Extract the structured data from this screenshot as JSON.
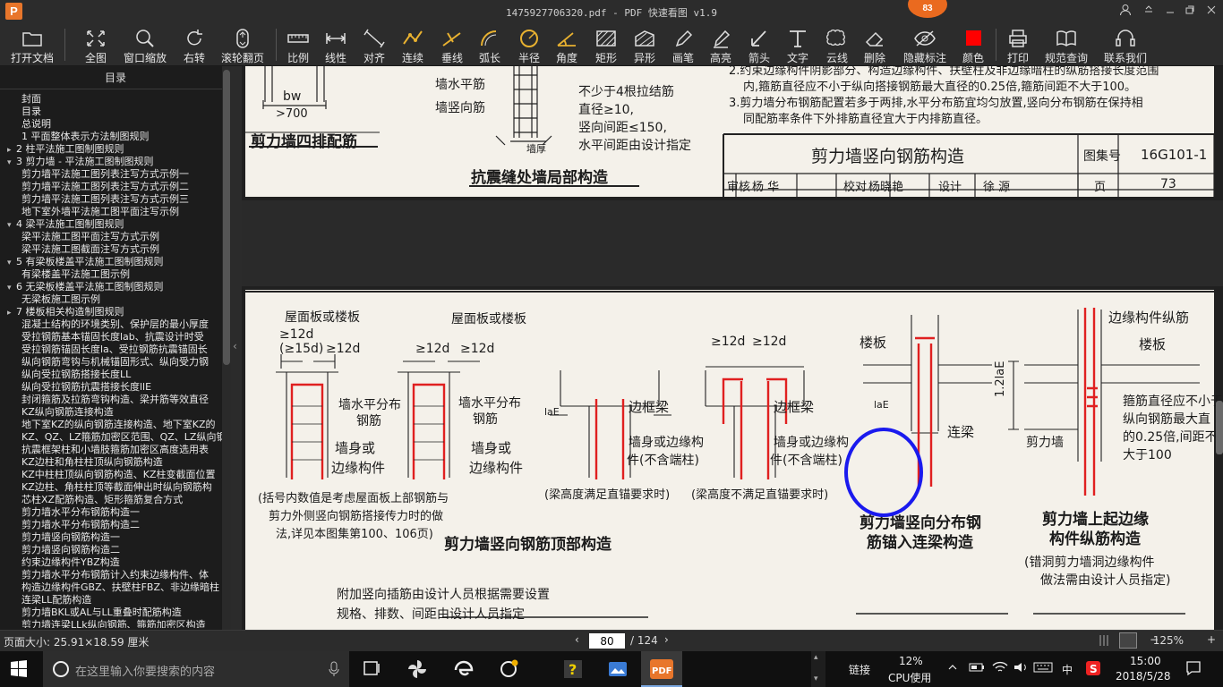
{
  "window": {
    "logo": "P",
    "title": "1475927706320.pdf - PDF 快速看图 v1.9",
    "badge": "83"
  },
  "toolbar": {
    "items": [
      {
        "label": "打开文档",
        "icon": "folder-icon"
      },
      {
        "label": "全图",
        "icon": "fit-page-icon"
      },
      {
        "label": "窗口缩放",
        "icon": "zoom-window-icon"
      },
      {
        "label": "右转",
        "icon": "rotate-right-icon"
      },
      {
        "label": "滚轮翻页",
        "icon": "mouse-wheel-icon"
      },
      {
        "label": "比例",
        "icon": "ruler-icon"
      },
      {
        "label": "线性",
        "icon": "linear-dimension-icon"
      },
      {
        "label": "对齐",
        "icon": "aligned-dimension-icon"
      },
      {
        "label": "连续",
        "icon": "continuous-dimension-icon"
      },
      {
        "label": "垂线",
        "icon": "perpendicular-icon"
      },
      {
        "label": "弧长",
        "icon": "arc-length-icon"
      },
      {
        "label": "半径",
        "icon": "radius-icon"
      },
      {
        "label": "角度",
        "icon": "angle-icon"
      },
      {
        "label": "矩形",
        "icon": "rectangle-area-icon"
      },
      {
        "label": "异形",
        "icon": "polygon-area-icon"
      },
      {
        "label": "画笔",
        "icon": "pencil-icon"
      },
      {
        "label": "高亮",
        "icon": "highlighter-icon"
      },
      {
        "label": "箭头",
        "icon": "arrow-icon"
      },
      {
        "label": "文字",
        "icon": "text-icon"
      },
      {
        "label": "云线",
        "icon": "cloud-line-icon"
      },
      {
        "label": "删除",
        "icon": "eraser-icon"
      },
      {
        "label": "隐藏标注",
        "icon": "eye-hidden-icon"
      },
      {
        "label": "颜色",
        "icon": "color-swatch-icon"
      },
      {
        "label": "打印",
        "icon": "printer-icon"
      },
      {
        "label": "规范查询",
        "icon": "book-search-icon"
      },
      {
        "label": "联系我们",
        "icon": "headset-icon"
      }
    ],
    "color_swatch": "#ff0000"
  },
  "sidebar": {
    "header": "目录",
    "items": [
      {
        "text": "封面",
        "level": 0,
        "twisty": ""
      },
      {
        "text": "目录",
        "level": 0,
        "twisty": ""
      },
      {
        "text": "总说明",
        "level": 0,
        "twisty": ""
      },
      {
        "text": "1 平面整体表示方法制图规则",
        "level": 0,
        "twisty": ""
      },
      {
        "text": "2 柱平法施工图制图规则",
        "level": 1,
        "twisty": "▸"
      },
      {
        "text": "3 剪力墙 - 平法施工图制图规则",
        "level": 1,
        "twisty": "▾"
      },
      {
        "text": "剪力墙平法施工图列表注写方式示例一",
        "level": 2,
        "twisty": ""
      },
      {
        "text": "剪力墙平法施工图列表注写方式示例二",
        "level": 2,
        "twisty": ""
      },
      {
        "text": "剪力墙平法施工图列表注写方式示例三",
        "level": 2,
        "twisty": ""
      },
      {
        "text": "地下室外墙平法施工图平面注写示例",
        "level": 2,
        "twisty": ""
      },
      {
        "text": "4 梁平法施工图制图规则",
        "level": 1,
        "twisty": "▾"
      },
      {
        "text": "梁平法施工图平面注写方式示例",
        "level": 2,
        "twisty": ""
      },
      {
        "text": "梁平法施工图截面注写方式示例",
        "level": 2,
        "twisty": ""
      },
      {
        "text": "5 有梁板楼盖平法施工图制图规则",
        "level": 1,
        "twisty": "▾"
      },
      {
        "text": "有梁楼盖平法施工图示例",
        "level": 2,
        "twisty": ""
      },
      {
        "text": "6 无梁板楼盖平法施工图制图规则",
        "level": 1,
        "twisty": "▾"
      },
      {
        "text": "无梁板施工图示例",
        "level": 2,
        "twisty": ""
      },
      {
        "text": "7 楼板相关构造制图规则",
        "level": 1,
        "twisty": "▸"
      },
      {
        "text": "混凝土结构的环境类别、保护层的最小厚度",
        "level": 2,
        "twisty": ""
      },
      {
        "text": "受拉钢筋基本锚固长度lab、抗震设计时受",
        "level": 2,
        "twisty": ""
      },
      {
        "text": "受拉钢筋锚固长度la、受拉钢筋抗震锚固长",
        "level": 2,
        "twisty": ""
      },
      {
        "text": "纵向钢筋弯钩与机械锚固形式、纵向受力钢",
        "level": 2,
        "twisty": ""
      },
      {
        "text": "纵向受拉钢筋搭接长度LL",
        "level": 2,
        "twisty": ""
      },
      {
        "text": "纵向受拉钢筋抗震搭接长度llE",
        "level": 2,
        "twisty": ""
      },
      {
        "text": "封闭箍筋及拉筋弯钩构造、梁并筋等效直径",
        "level": 2,
        "twisty": ""
      },
      {
        "text": "KZ纵向钢筋连接构造",
        "level": 2,
        "twisty": ""
      },
      {
        "text": "地下室KZ的纵向钢筋连接构造、地下室KZ的",
        "level": 2,
        "twisty": ""
      },
      {
        "text": "KZ、QZ、LZ箍筋加密区范围、QZ、LZ纵向钢",
        "level": 2,
        "twisty": ""
      },
      {
        "text": "抗震框架柱和小墙肢箍筋加密区高度选用表",
        "level": 2,
        "twisty": ""
      },
      {
        "text": "KZ边柱和角柱柱顶纵向钢筋构造",
        "level": 2,
        "twisty": ""
      },
      {
        "text": "KZ中柱柱顶纵向钢筋构造、KZ柱变截面位置",
        "level": 2,
        "twisty": ""
      },
      {
        "text": "KZ边柱、角柱柱顶等截面伸出时纵向钢筋构",
        "level": 2,
        "twisty": ""
      },
      {
        "text": "芯柱XZ配筋构造、矩形箍筋复合方式",
        "level": 2,
        "twisty": ""
      },
      {
        "text": "剪力墙水平分布钢筋构造一",
        "level": 2,
        "twisty": ""
      },
      {
        "text": "剪力墙水平分布钢筋构造二",
        "level": 2,
        "twisty": ""
      },
      {
        "text": "剪力墙竖向钢筋构造一",
        "level": 2,
        "twisty": ""
      },
      {
        "text": "剪力墙竖向钢筋构造二",
        "level": 2,
        "twisty": ""
      },
      {
        "text": "约束边缘构件YBZ构造",
        "level": 2,
        "twisty": ""
      },
      {
        "text": "剪力墙水平分布钢筋计入约束边缘构件、体",
        "level": 2,
        "twisty": ""
      },
      {
        "text": "构造边缘构件GBZ、扶壁柱FBZ、非边缘暗柱",
        "level": 2,
        "twisty": ""
      },
      {
        "text": "连梁LL配筋构造",
        "level": 2,
        "twisty": ""
      },
      {
        "text": "剪力墙BKL或AL与LL重叠时配筋构造",
        "level": 2,
        "twisty": ""
      },
      {
        "text": "剪力墙连梁LLk纵向钢筋、箍筋加密区构造",
        "level": 2,
        "twisty": ""
      }
    ]
  },
  "document": {
    "top": {
      "label_bw": "bw",
      "label_700": ">700",
      "title_four_row": "剪力墙四排配筋",
      "h_bar": "墙水平筋",
      "v_bar": "墙竖向筋",
      "note1": "不少于4根拉结筋",
      "note2": "直径≥10,",
      "note3": "竖向间距≤150,",
      "note4": "水平间距由设计指定",
      "wall_thick": "墙厚",
      "title_seismic": "抗震缝处墙局部构造",
      "spec_line1": "2.约束边缘构件阴影部分、构造边缘构件、扶壁柱及非边缘暗柱的纵筋搭接长度范围",
      "spec_line2": "内,箍筋直径应不小于纵向搭接钢筋最大直径的0.25倍,箍筋间距不大于100。",
      "spec_line3": "3.剪力墙分布钢筋配置若多于两排,水平分布筋宜均匀放置,竖向分布钢筋在保持相",
      "spec_line4": "同配筋率条件下外排筋直径宜大于内排筋直径。",
      "title_block": {
        "title": "剪力墙竖向钢筋构造",
        "atlas_label": "图集号",
        "atlas_no": "16G101-1",
        "review_label": "审核",
        "reviewer": "杨 华",
        "check_label": "校对",
        "checker": "杨晓艳",
        "design_label": "设计",
        "designer": "徐 源",
        "page_label": "页",
        "page_no": "73"
      }
    },
    "bottom": {
      "roof_slab_1": "屋面板或楼板",
      "roof_slab_2": "屋面板或楼板",
      "dim_12d_a": "≥12d",
      "dim_15d": "(≥15d)",
      "dim_12d_b": "≥12d",
      "dim_12d_c": "≥12d",
      "dim_12d_d": "≥12d",
      "dim_12d_e": "≥12d",
      "dim_12d_f": "≥12d",
      "h_bar_1": "墙水平分布",
      "h_bar_1b": "钢筋",
      "h_bar_2": "墙水平分布",
      "h_bar_2b": "钢筋",
      "wall_1": "墙身或",
      "wall_1b": "边缘构件",
      "wall_2": "墙身或",
      "wall_2b": "边缘构件",
      "frame_beam_1": "边框梁",
      "frame_beam_2": "边框梁",
      "wall_3": "墙身或边缘构",
      "wall_3b": "件(不含端柱)",
      "wall_4": "墙身或边缘构",
      "wall_4b": "件(不含端柱)",
      "lae_1": "laE",
      "note_paren1": "(括号内数值是考虑屋面板上部钢筋与",
      "note_paren2": "剪力外侧竖向钢筋搭接传力时的做",
      "note_paren3": "法,详见本图集第100、106页)",
      "beam_ok": "(梁高度满足直锚要求时)",
      "beam_not_ok": "(梁高度不满足直锚要求时)",
      "title_top": "剪力墙竖向钢筋顶部构造",
      "floor_slab": "楼板",
      "lae_2": "laE",
      "coupling_beam": "连梁",
      "title_anchor_1": "剪力墙竖向分布钢",
      "title_anchor_2": "筋锚入连梁构造",
      "edge_member": "边缘构件纵筋",
      "floor_slab_2": "楼板",
      "dim_12lae": "1.2laE",
      "stirrup_1": "箍筋直径应不小于",
      "stirrup_2": "纵向钢筋最大直",
      "stirrup_3": "的0.25倍,间距不",
      "stirrup_4": "大于100",
      "shear_wall": "剪力墙",
      "title_edge_1": "剪力墙上起边缘",
      "title_edge_2": "构件纵筋构造",
      "edge_note_1": "(错洞剪力墙洞边缘构件",
      "edge_note_2": "做法需由设计人员指定)",
      "extra_bar_1": "附加竖向插筋由设计人员根据需要设置",
      "extra_bar_2": "规格、排数、间距由设计人员指定"
    }
  },
  "statusbar": {
    "page_size": "页面大小: 25.91×18.59 厘米",
    "current_page": "80",
    "total_pages": "/ 124",
    "zoom": "125%",
    "zoom_minus": "−",
    "zoom_plus": "+"
  },
  "taskbar": {
    "search_placeholder": "在这里输入你要搜索的内容",
    "link_label": "链接",
    "cpu_percent": "12%",
    "cpu_label": "CPU使用",
    "ime": "中",
    "time": "15:00",
    "date": "2018/5/28"
  },
  "colors": {
    "rebar_red": "#e02020",
    "annotation_blue": "#1a1aee",
    "accent_orange": "#ea6a1f"
  }
}
